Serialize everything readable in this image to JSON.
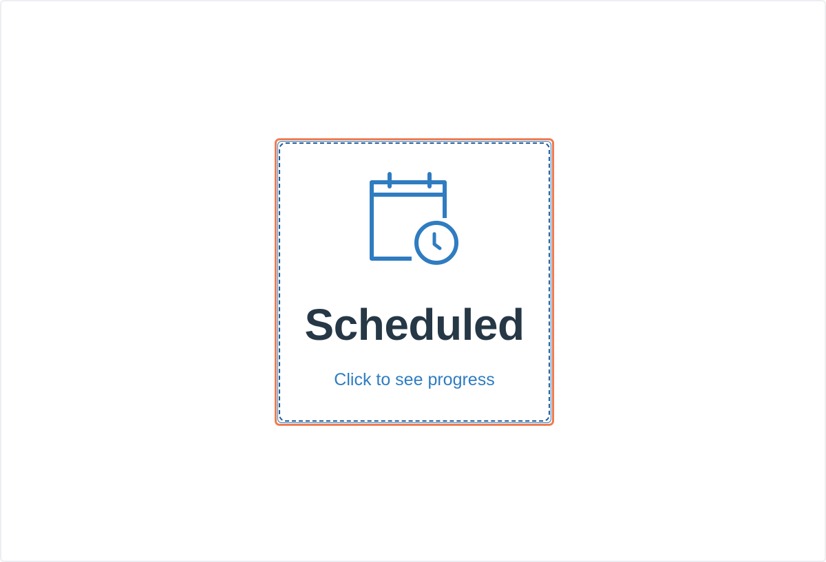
{
  "status_card": {
    "icon": "calendar-clock-icon",
    "title": "Scheduled",
    "link_label": "Click to see progress"
  },
  "colors": {
    "accent": "#2f7cc1",
    "focus_outline": "#f07b4f",
    "title_text": "#263746"
  }
}
